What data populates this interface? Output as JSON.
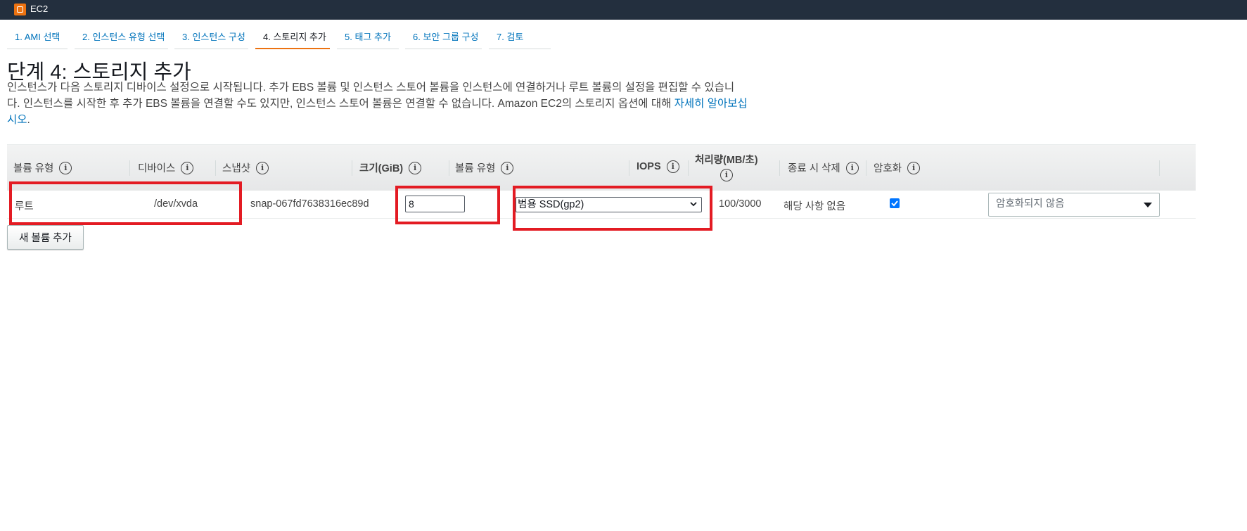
{
  "app": {
    "title": "EC2"
  },
  "steps": [
    {
      "label": "1. AMI 선택"
    },
    {
      "label": "2. 인스턴스 유형 선택"
    },
    {
      "label": "3. 인스턴스 구성"
    },
    {
      "label": "4. 스토리지 추가"
    },
    {
      "label": "5. 태그 추가"
    },
    {
      "label": "6. 보안 그룹 구성"
    },
    {
      "label": "7. 검토"
    }
  ],
  "active_step": "4. 스토리지 추가",
  "page": {
    "title": "단계 4: 스토리지 추가",
    "description_line1": "인스턴스가 다음 스토리지 디바이스 설정으로 시작됩니다. 추가 EBS 볼륨 및 인스턴스 스토어 볼륨을 인스턴스에 연결하거나 루트 볼륨의 설정을 편집할 수 있습니",
    "description_line2": "다. 인스턴스를 시작한 후 추가 EBS 볼륨을 연결할 수도 있지만, 인스턴스 스토어 볼륨은 연결할 수 없습니다. Amazon EC2의 스토리지 옵션에 대해 ",
    "learn_more_link_a": "자세히 알아보십",
    "learn_more_link_b": "시오",
    "description_end": "."
  },
  "table": {
    "headers": {
      "volume_type": "볼륨 유형",
      "device": "디바이스",
      "snapshot": "스냅샷",
      "size": "크기(GiB)",
      "ebs_volume_type": "볼륨 유형",
      "iops": "IOPS",
      "throughput": "처리량(MB/초)",
      "delete_on_termination": "종료 시 삭제",
      "encryption": "암호화"
    },
    "rows": [
      {
        "volume_type": "루트",
        "device": "/dev/xvda",
        "snapshot": "snap-067fd7638316ec89d",
        "size": "8",
        "ebs_volume_type": "범용 SSD(gp2)",
        "iops": "100/3000",
        "throughput": "해당 사항 없음",
        "delete_on_termination": true,
        "encryption": "암호화되지 않음"
      }
    ]
  },
  "buttons": {
    "add_volume": "새 볼륨 추가"
  },
  "colors": {
    "topbar": "#232f3e",
    "link": "#0073bb",
    "active_tab_underline": "#ec7211",
    "highlight": "#e31b23",
    "checkbox": "#0075ff"
  }
}
